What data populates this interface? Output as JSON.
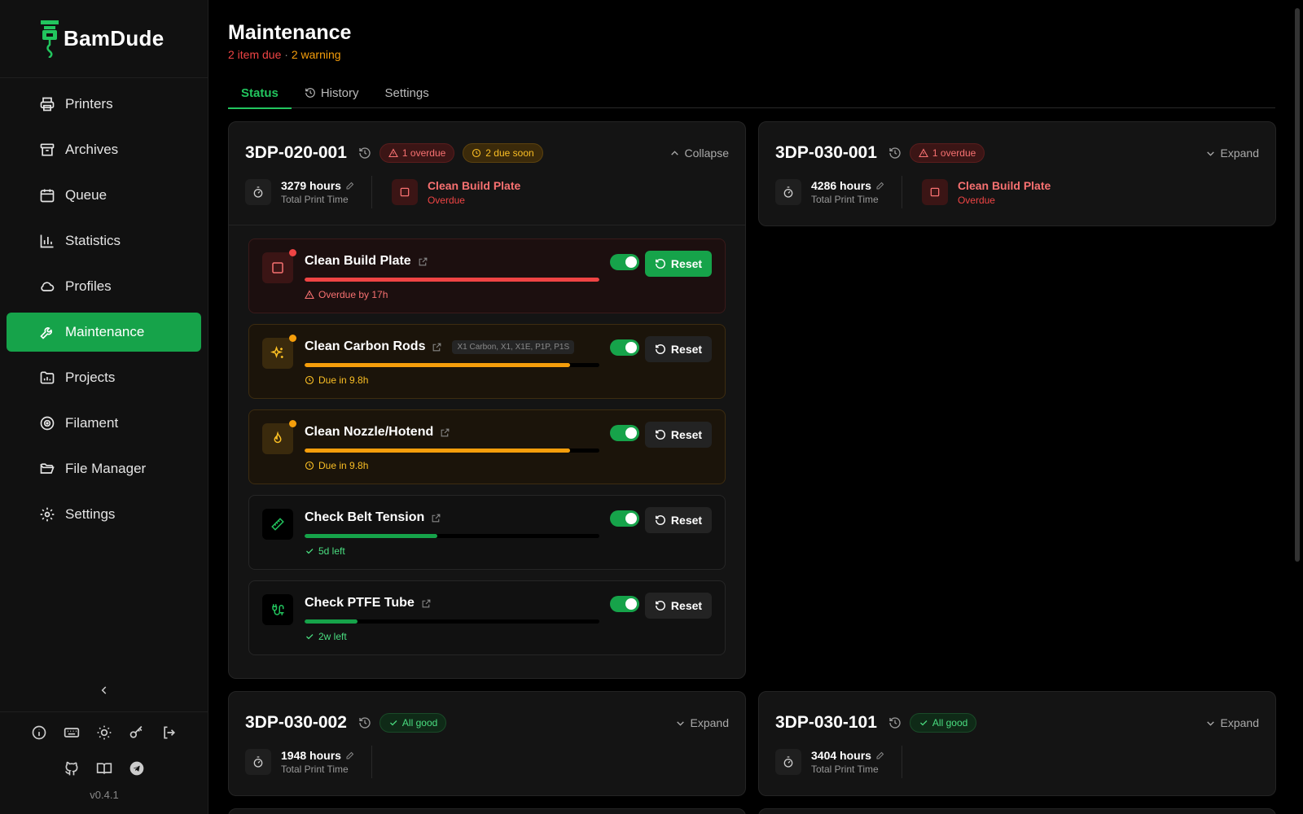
{
  "brand": {
    "name": "BamDude",
    "version": "v0.4.1"
  },
  "nav": [
    {
      "id": "printers",
      "label": "Printers",
      "icon": "printer-icon"
    },
    {
      "id": "archives",
      "label": "Archives",
      "icon": "archive-icon"
    },
    {
      "id": "queue",
      "label": "Queue",
      "icon": "calendar-icon"
    },
    {
      "id": "statistics",
      "label": "Statistics",
      "icon": "bar-chart-icon"
    },
    {
      "id": "profiles",
      "label": "Profiles",
      "icon": "cloud-icon"
    },
    {
      "id": "maintenance",
      "label": "Maintenance",
      "icon": "wrench-icon",
      "active": true
    },
    {
      "id": "projects",
      "label": "Projects",
      "icon": "folder-chart-icon"
    },
    {
      "id": "filament",
      "label": "Filament",
      "icon": "spool-icon"
    },
    {
      "id": "file-manager",
      "label": "File Manager",
      "icon": "folder-open-icon"
    },
    {
      "id": "settings",
      "label": "Settings",
      "icon": "gear-icon"
    }
  ],
  "footer_icons": [
    "info-icon",
    "keyboard-icon",
    "sun-icon",
    "key-icon",
    "logout-icon",
    "github-icon",
    "book-icon",
    "telegram-icon"
  ],
  "page": {
    "title": "Maintenance",
    "due_text": "2 item due",
    "separator": " · ",
    "warning_text": "2 warning"
  },
  "tabs": [
    {
      "label": "Status",
      "active": true
    },
    {
      "label": "History",
      "icon": "history-icon"
    },
    {
      "label": "Settings"
    }
  ],
  "common": {
    "total_print_time": "Total Print Time",
    "reset": "Reset",
    "collapse": "Collapse",
    "expand": "Expand",
    "all_good": "All good"
  },
  "printers": [
    {
      "name": "3DP-020-001",
      "badges": [
        {
          "text": "1 overdue",
          "tone": "red"
        },
        {
          "text": "2 due soon",
          "tone": "amber"
        }
      ],
      "hours": "3279 hours",
      "alert": {
        "title": "Clean Build Plate",
        "sub": "Overdue"
      },
      "expanded": true,
      "tasks": [
        {
          "name": "Clean Build Plate",
          "tone": "red",
          "icon": "square-icon",
          "progress": 1.0,
          "status": "Overdue by 17h",
          "models": ""
        },
        {
          "name": "Clean Carbon Rods",
          "tone": "amber",
          "icon": "sparkles-icon",
          "progress": 0.9,
          "status": "Due in 9.8h",
          "models": "X1 Carbon, X1, X1E, P1P, P1S"
        },
        {
          "name": "Clean Nozzle/Hotend",
          "tone": "amber",
          "icon": "flame-icon",
          "progress": 0.9,
          "status": "Due in 9.8h",
          "models": ""
        },
        {
          "name": "Check Belt Tension",
          "tone": "green",
          "icon": "ruler-icon",
          "progress": 0.45,
          "status": "5d left",
          "models": ""
        },
        {
          "name": "Check PTFE Tube",
          "tone": "green",
          "icon": "cable-icon",
          "progress": 0.18,
          "status": "2w left",
          "models": ""
        }
      ]
    },
    {
      "name": "3DP-030-001",
      "badges": [
        {
          "text": "1 overdue",
          "tone": "red"
        }
      ],
      "hours": "4286 hours",
      "alert": {
        "title": "Clean Build Plate",
        "sub": "Overdue"
      },
      "expanded": false
    },
    {
      "name": "3DP-030-002",
      "badges": [
        {
          "text": "All good",
          "tone": "green"
        }
      ],
      "hours": "1948 hours",
      "expanded": false
    },
    {
      "name": "3DP-030-101",
      "badges": [
        {
          "text": "All good",
          "tone": "green"
        }
      ],
      "hours": "3404 hours",
      "expanded": false
    }
  ],
  "colors": {
    "accent": "#16a34a",
    "danger": "#ef4444",
    "warning": "#f59e0b",
    "bg": "#000000",
    "panel": "#141414"
  }
}
